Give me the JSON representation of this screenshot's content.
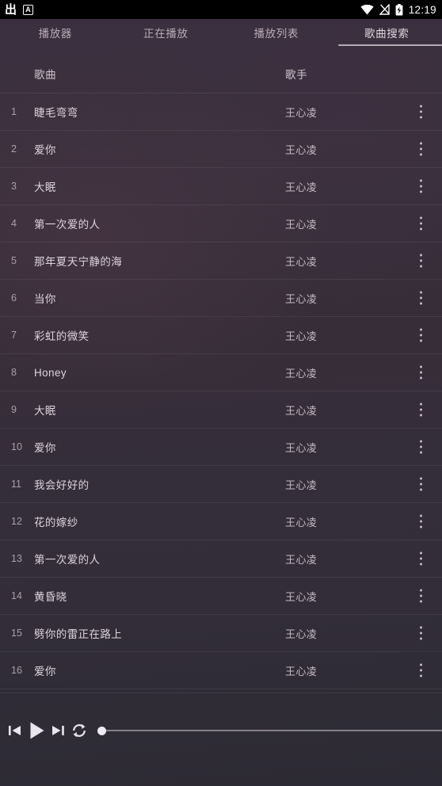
{
  "statusbar": {
    "ime_glyph": "出",
    "keyboard_badge": "A",
    "icons": [
      "wifi-icon",
      "signal-off-icon",
      "battery-charging-icon"
    ],
    "time": "12:19"
  },
  "tabs": [
    {
      "label": "播放器",
      "active": false
    },
    {
      "label": "正在播放",
      "active": false
    },
    {
      "label": "播放列表",
      "active": false
    },
    {
      "label": "歌曲搜索",
      "active": true
    }
  ],
  "columns": {
    "song": "歌曲",
    "artist": "歌手"
  },
  "rows": [
    {
      "index": "1",
      "title": "睫毛弯弯",
      "artist": "王心凌"
    },
    {
      "index": "2",
      "title": "爱你",
      "artist": "王心凌"
    },
    {
      "index": "3",
      "title": "大眠",
      "artist": "王心凌"
    },
    {
      "index": "4",
      "title": "第一次爱的人",
      "artist": "王心凌"
    },
    {
      "index": "5",
      "title": "那年夏天宁静的海",
      "artist": "王心凌"
    },
    {
      "index": "6",
      "title": "当你",
      "artist": "王心凌"
    },
    {
      "index": "7",
      "title": "彩虹的微笑",
      "artist": "王心凌"
    },
    {
      "index": "8",
      "title": "Honey",
      "artist": "王心凌"
    },
    {
      "index": "9",
      "title": "大眠",
      "artist": "王心凌"
    },
    {
      "index": "10",
      "title": "爱你",
      "artist": "王心凌"
    },
    {
      "index": "11",
      "title": "我会好好的",
      "artist": "王心凌"
    },
    {
      "index": "12",
      "title": "花的嫁纱",
      "artist": "王心凌"
    },
    {
      "index": "13",
      "title": "第一次爱的人",
      "artist": "王心凌"
    },
    {
      "index": "14",
      "title": "黄昏晓",
      "artist": "王心凌"
    },
    {
      "index": "15",
      "title": "劈你的雷正在路上",
      "artist": "王心凌"
    },
    {
      "index": "16",
      "title": "爱你",
      "artist": "王心凌"
    }
  ],
  "player": {
    "controls": [
      "previous-track-icon",
      "play-icon",
      "next-track-icon",
      "repeat-icon"
    ],
    "seek_percent": 0
  },
  "colors": {
    "bg_top": "#3b3040",
    "bg_bottom": "#2c2a34",
    "text_primary": "#ddd4dc",
    "text_secondary": "#b9aab6",
    "tab_indicator": "#b3adb5",
    "statusbar_bg": "#000000"
  }
}
